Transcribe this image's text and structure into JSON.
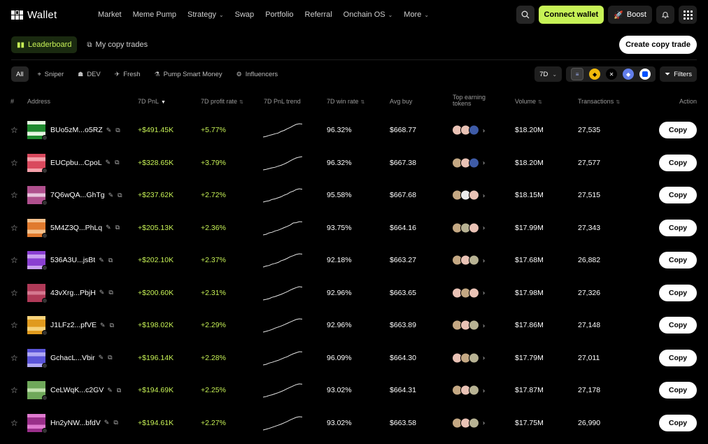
{
  "app": {
    "title": "Wallet"
  },
  "nav": {
    "items": [
      {
        "label": "Market",
        "dropdown": false
      },
      {
        "label": "Meme Pump",
        "dropdown": false
      },
      {
        "label": "Strategy",
        "dropdown": true
      },
      {
        "label": "Swap",
        "dropdown": false
      },
      {
        "label": "Portfolio",
        "dropdown": false
      },
      {
        "label": "Referral",
        "dropdown": false
      },
      {
        "label": "Onchain OS",
        "dropdown": true
      },
      {
        "label": "More",
        "dropdown": true
      }
    ],
    "connect_label": "Connect wallet",
    "boost_label": "Boost"
  },
  "tabs": {
    "leaderboard": "Leaderboard",
    "my_copy_trades": "My copy trades",
    "create_label": "Create copy trade"
  },
  "filters": {
    "chips": [
      "All",
      "Sniper",
      "DEV",
      "Fresh",
      "Pump Smart Money",
      "Influencers"
    ],
    "period": "7D",
    "filters_label": "Filters"
  },
  "colors": {
    "accent": "#c7f256",
    "bg": "#000000"
  },
  "table": {
    "headers": {
      "index": "#",
      "address": "Address",
      "pnl": "7D PnL",
      "profit_rate": "7D profit rate",
      "trend": "7D PnL trend",
      "win_rate": "7D win rate",
      "avg_buy": "Avg buy",
      "top_tokens": "Top earning tokens",
      "volume": "Volume",
      "transactions": "Transactions",
      "action": "Action"
    },
    "copy_label": "Copy",
    "rows": [
      {
        "address": "BUo5zM...o5RZ",
        "pnl": "+$491.45K",
        "rate": "+5.77%",
        "win": "96.32%",
        "avg": "$668.77",
        "volume": "$18.20M",
        "tx": "27,535",
        "colors": [
          "#1f8a2e",
          "#e6f5e1"
        ],
        "tokens": [
          "a",
          "a",
          "c"
        ]
      },
      {
        "address": "EUCpbu...CpoL",
        "pnl": "+$328.65K",
        "rate": "+3.79%",
        "win": "96.32%",
        "avg": "$667.38",
        "volume": "$18.20M",
        "tx": "27,577",
        "colors": [
          "#d9495d",
          "#f4a0aa"
        ],
        "tokens": [
          "b",
          "a",
          "c"
        ]
      },
      {
        "address": "7Q6wQA...GhTg",
        "pnl": "+$237.62K",
        "rate": "+2.72%",
        "win": "95.58%",
        "avg": "$667.68",
        "volume": "$18.15M",
        "tx": "27,515",
        "colors": [
          "#b0508e",
          "#e7c2dc"
        ],
        "tokens": [
          "b",
          "d",
          "a"
        ]
      },
      {
        "address": "5M4Z3Q...PhLq",
        "pnl": "+$205.13K",
        "rate": "+2.36%",
        "win": "93.75%",
        "avg": "$664.16",
        "volume": "$17.99M",
        "tx": "27,343",
        "colors": [
          "#e07a2e",
          "#f4c08c"
        ],
        "tokens": [
          "b",
          "e",
          "a"
        ]
      },
      {
        "address": "536A3U...jsBt",
        "pnl": "+$202.10K",
        "rate": "+2.37%",
        "win": "92.18%",
        "avg": "$663.27",
        "volume": "$17.68M",
        "tx": "26,882",
        "colors": [
          "#8a3fd1",
          "#c9a0f0"
        ],
        "tokens": [
          "b",
          "a",
          "e"
        ]
      },
      {
        "address": "43vXrg...PbjH",
        "pnl": "+$200.60K",
        "rate": "+2.31%",
        "win": "92.96%",
        "avg": "$663.65",
        "volume": "$17.98M",
        "tx": "27,326",
        "colors": [
          "#b03a58",
          "#d57890"
        ],
        "tokens": [
          "a",
          "b",
          "a"
        ]
      },
      {
        "address": "J1LFz2...pfVE",
        "pnl": "+$198.02K",
        "rate": "+2.29%",
        "win": "92.96%",
        "avg": "$663.89",
        "volume": "$17.86M",
        "tx": "27,148",
        "colors": [
          "#e09a1e",
          "#f6d27a"
        ],
        "tokens": [
          "b",
          "a",
          "e"
        ]
      },
      {
        "address": "GchacL...Vbir",
        "pnl": "+$196.14K",
        "rate": "+2.28%",
        "win": "96.09%",
        "avg": "$664.30",
        "volume": "$17.79M",
        "tx": "27,011",
        "colors": [
          "#5b55d8",
          "#b0a8f4"
        ],
        "tokens": [
          "a",
          "b",
          "e"
        ]
      },
      {
        "address": "CeLWqK...c2GV",
        "pnl": "+$194.69K",
        "rate": "+2.25%",
        "win": "93.02%",
        "avg": "$664.31",
        "volume": "$17.87M",
        "tx": "27,178",
        "colors": [
          "#6fa85a",
          "#c2e2ae"
        ],
        "tokens": [
          "b",
          "a",
          "e"
        ]
      },
      {
        "address": "Hn2yNW...bfdV",
        "pnl": "+$194.61K",
        "rate": "+2.27%",
        "win": "93.02%",
        "avg": "$663.58",
        "volume": "$17.75M",
        "tx": "26,990",
        "colors": [
          "#9a2f8a",
          "#e07ad0"
        ],
        "tokens": [
          "b",
          "a",
          "e"
        ]
      }
    ]
  }
}
